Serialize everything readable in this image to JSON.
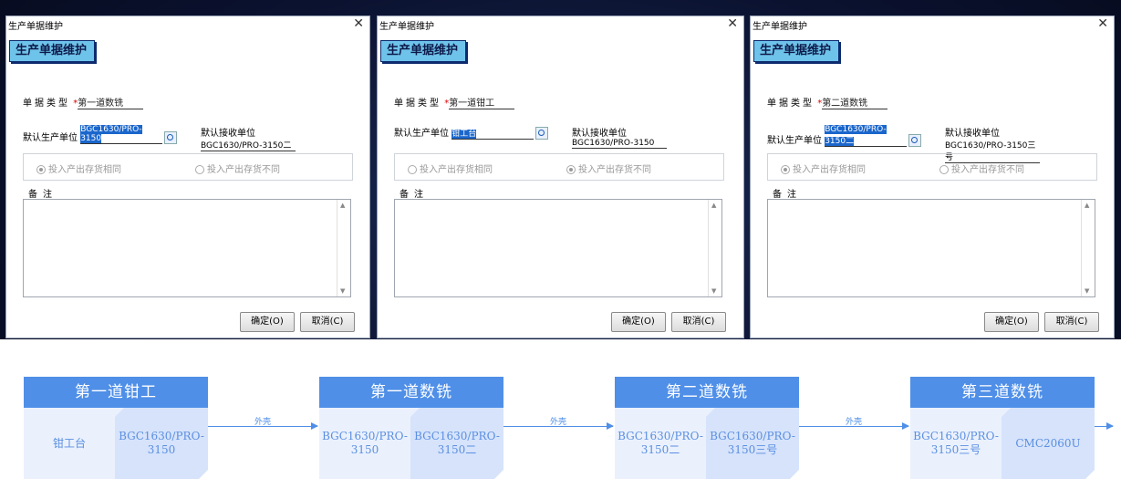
{
  "dialogs": [
    {
      "window_title": "生产单据维护",
      "heading": "生产单据维护",
      "doc_type_label": "单据类型",
      "doc_type_value": "第一道数铣",
      "default_prod_unit_label": "默认生产单位",
      "default_prod_unit_value": "BGC1630/PRO-3150",
      "default_recv_unit_label": "默认接收单位",
      "default_recv_unit_value": "BGC1630/PRO-3150二",
      "radio_same": "投入产出存货相同",
      "radio_diff": "投入产出存货不同",
      "selected_radio": "same",
      "notes_label": "备注",
      "ok_label": "确定(O)",
      "cancel_label": "取消(C)"
    },
    {
      "window_title": "生产单据维护",
      "heading": "生产单据维护",
      "doc_type_label": "单据类型",
      "doc_type_value": "第一道钳工",
      "default_prod_unit_label": "默认生产单位",
      "default_prod_unit_value": "钳工台",
      "default_recv_unit_label": "默认接收单位",
      "default_recv_unit_value": "BGC1630/PRO-3150",
      "radio_same": "投入产出存货相同",
      "radio_diff": "投入产出存货不同",
      "selected_radio": "diff",
      "notes_label": "备注",
      "ok_label": "确定(O)",
      "cancel_label": "取消(C)"
    },
    {
      "window_title": "生产单据维护",
      "heading": "生产单据维护",
      "doc_type_label": "单据类型",
      "doc_type_value": "第二道数铣",
      "default_prod_unit_label": "默认生产单位",
      "default_prod_unit_value": "BGC1630/PRO-3150二",
      "default_recv_unit_label": "默认接收单位",
      "default_recv_unit_value": "BGC1630/PRO-3150三号",
      "radio_same": "投入产出存货相同",
      "radio_diff": "投入产出存货不同",
      "selected_radio": "same",
      "notes_label": "备注",
      "ok_label": "确定(O)",
      "cancel_label": "取消(C)"
    }
  ],
  "flow": {
    "stages": [
      {
        "title": "第一道钳工",
        "input": "钳工台",
        "output": "BGC1630/PRO-3150"
      },
      {
        "title": "第一道数铣",
        "input": "BGC1630/PRO-3150",
        "output": "BGC1630/PRO-3150二"
      },
      {
        "title": "第二道数铣",
        "input": "BGC1630/PRO-3150二",
        "output": "BGC1630/PRO-3150三号"
      },
      {
        "title": "第三道数铣",
        "input": "BGC1630/PRO-3150三号",
        "output": "CMC2060U"
      }
    ],
    "arrows": [
      "外壳",
      "外壳",
      "外壳",
      ""
    ],
    "colors": {
      "stage_header": "#4f8fe8",
      "stage_body": "#eaf1fd",
      "text": "#5b8fe0"
    }
  }
}
